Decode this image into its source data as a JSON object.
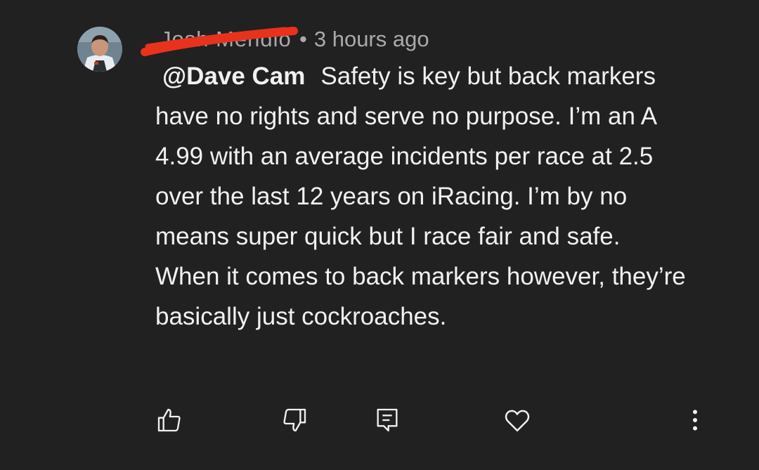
{
  "comment": {
    "author": "Josh Mendio",
    "separator": "•",
    "timestamp": "3 hours ago",
    "mention": "@Dave Cam",
    "body": "Safety is key but back markers have no rights and serve no purpose. I’m an A 4.99 with an average incidents per race at 2.5 over the last 12 years on iRacing. I’m by no means super quick but I race fair and safe. When it comes to back markers however, they’re basically just cockroaches."
  },
  "actions": {
    "like_icon": "thumbs-up-icon",
    "dislike_icon": "thumbs-down-icon",
    "reply_icon": "reply-icon",
    "heart_icon": "heart-icon",
    "more_icon": "more-vertical-icon"
  },
  "colors": {
    "background": "#212121",
    "text": "#f1f1f1",
    "meta": "#aaaaaa",
    "redaction": "#e8321c"
  }
}
